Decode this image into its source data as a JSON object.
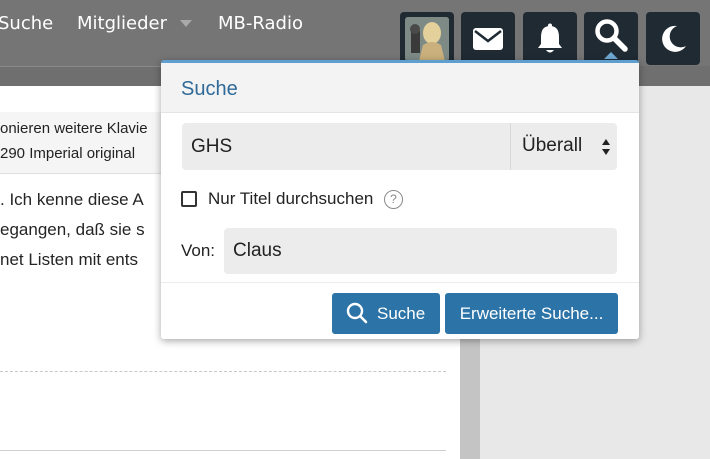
{
  "nav": {
    "items": [
      {
        "label": "Suche"
      },
      {
        "label": "Mitglieder"
      },
      {
        "label": "MB-Radio"
      }
    ],
    "icons": [
      "avatar",
      "envelope-icon",
      "bell-icon",
      "search-icon",
      "moon-icon"
    ]
  },
  "background": {
    "snippet_lines": [
      "onieren weitere Klavie",
      "290 Imperial original"
    ],
    "body_lines": [
      ". Ich kenne diese A",
      "egangen, daß sie s",
      "net Listen mit ents"
    ]
  },
  "popup": {
    "title": "Suche",
    "search_value": "GHS",
    "scope_selected": "Überall",
    "title_only_label": "Nur Titel durchsuchen",
    "help_symbol": "?",
    "from_label": "Von:",
    "from_value": "Claus",
    "search_button": "Suche",
    "advanced_button": "Erweiterte Suche..."
  },
  "colors": {
    "nav_bg": "#757575",
    "icon_button_bg": "#202a33",
    "accent": "#2c74a7",
    "title_color": "#2f6a99"
  }
}
